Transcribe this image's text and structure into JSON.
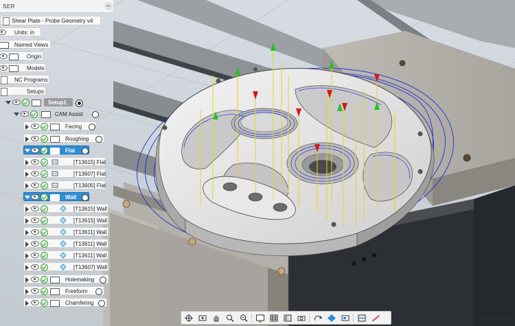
{
  "browser": {
    "title": "SER",
    "collapse_glyph": "–",
    "document_name": "Shear Plate - Probe Geometry v4",
    "units": "Units: in",
    "named_views": "Named Views",
    "origin": "Origin",
    "models": "Models",
    "nc_programs": "NC Programs",
    "setups": "Setups",
    "setup1": "Setup1",
    "cam_assist": "CAM Assist",
    "facing": "Facing",
    "roughing": "Roughing",
    "flat": "Flat",
    "flat_ops": [
      "[T13615] Flat",
      "[T13607] Flat",
      "[T13605] Flat"
    ],
    "wall": "Wall",
    "wall_ops": [
      "[T13615] Wall",
      "[T13615] Wall",
      "[T13611] Wall",
      "[T13611] Wall",
      "[T13611] Wall",
      "[T13607] Wall"
    ],
    "holemaking": "Holemaking",
    "freeform": "Freeform",
    "chamfering": "Chamfering"
  },
  "status": {
    "operations": "2 Operations"
  },
  "toolbar_icons": [
    "orbit-icon",
    "pan-icon",
    "hand-icon",
    "zoom-icon",
    "zoom-window-icon",
    "display-settings-icon",
    "grid-icon",
    "layout-icon",
    "camera-icon",
    "visual-style-icon",
    "environment-icon",
    "effects-icon",
    "section-icon",
    "measure-icon"
  ],
  "colors": {
    "selection": "#2f8fd6",
    "toolpath_blue": "#1e2fd6",
    "toolpath_yellow": "#e8d21c",
    "arrow_green": "#2bbd2b",
    "arrow_red": "#d41a1a"
  }
}
